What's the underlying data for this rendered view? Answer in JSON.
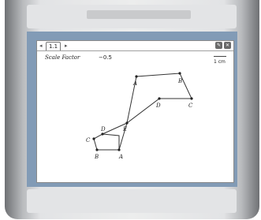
{
  "tab": {
    "label": "1.1",
    "left_arrow": "◂",
    "right_arrow": "▸"
  },
  "window_icons": [
    {
      "name": "tool-icon",
      "glyph": "✎"
    },
    {
      "name": "close-icon",
      "glyph": "✕"
    }
  ],
  "scale_factor": {
    "label": "Scale Factor",
    "value": "−0.5"
  },
  "unit": {
    "label": "1 cm"
  },
  "points": {
    "A": "A",
    "B": "B",
    "C": "C",
    "D": "D",
    "E": "E",
    "A_prime": "A",
    "B_prime": "B",
    "C_prime": "C",
    "D_prime": "D"
  },
  "colors": {
    "screen_frame": "#829bb6",
    "lines": "#333333"
  }
}
